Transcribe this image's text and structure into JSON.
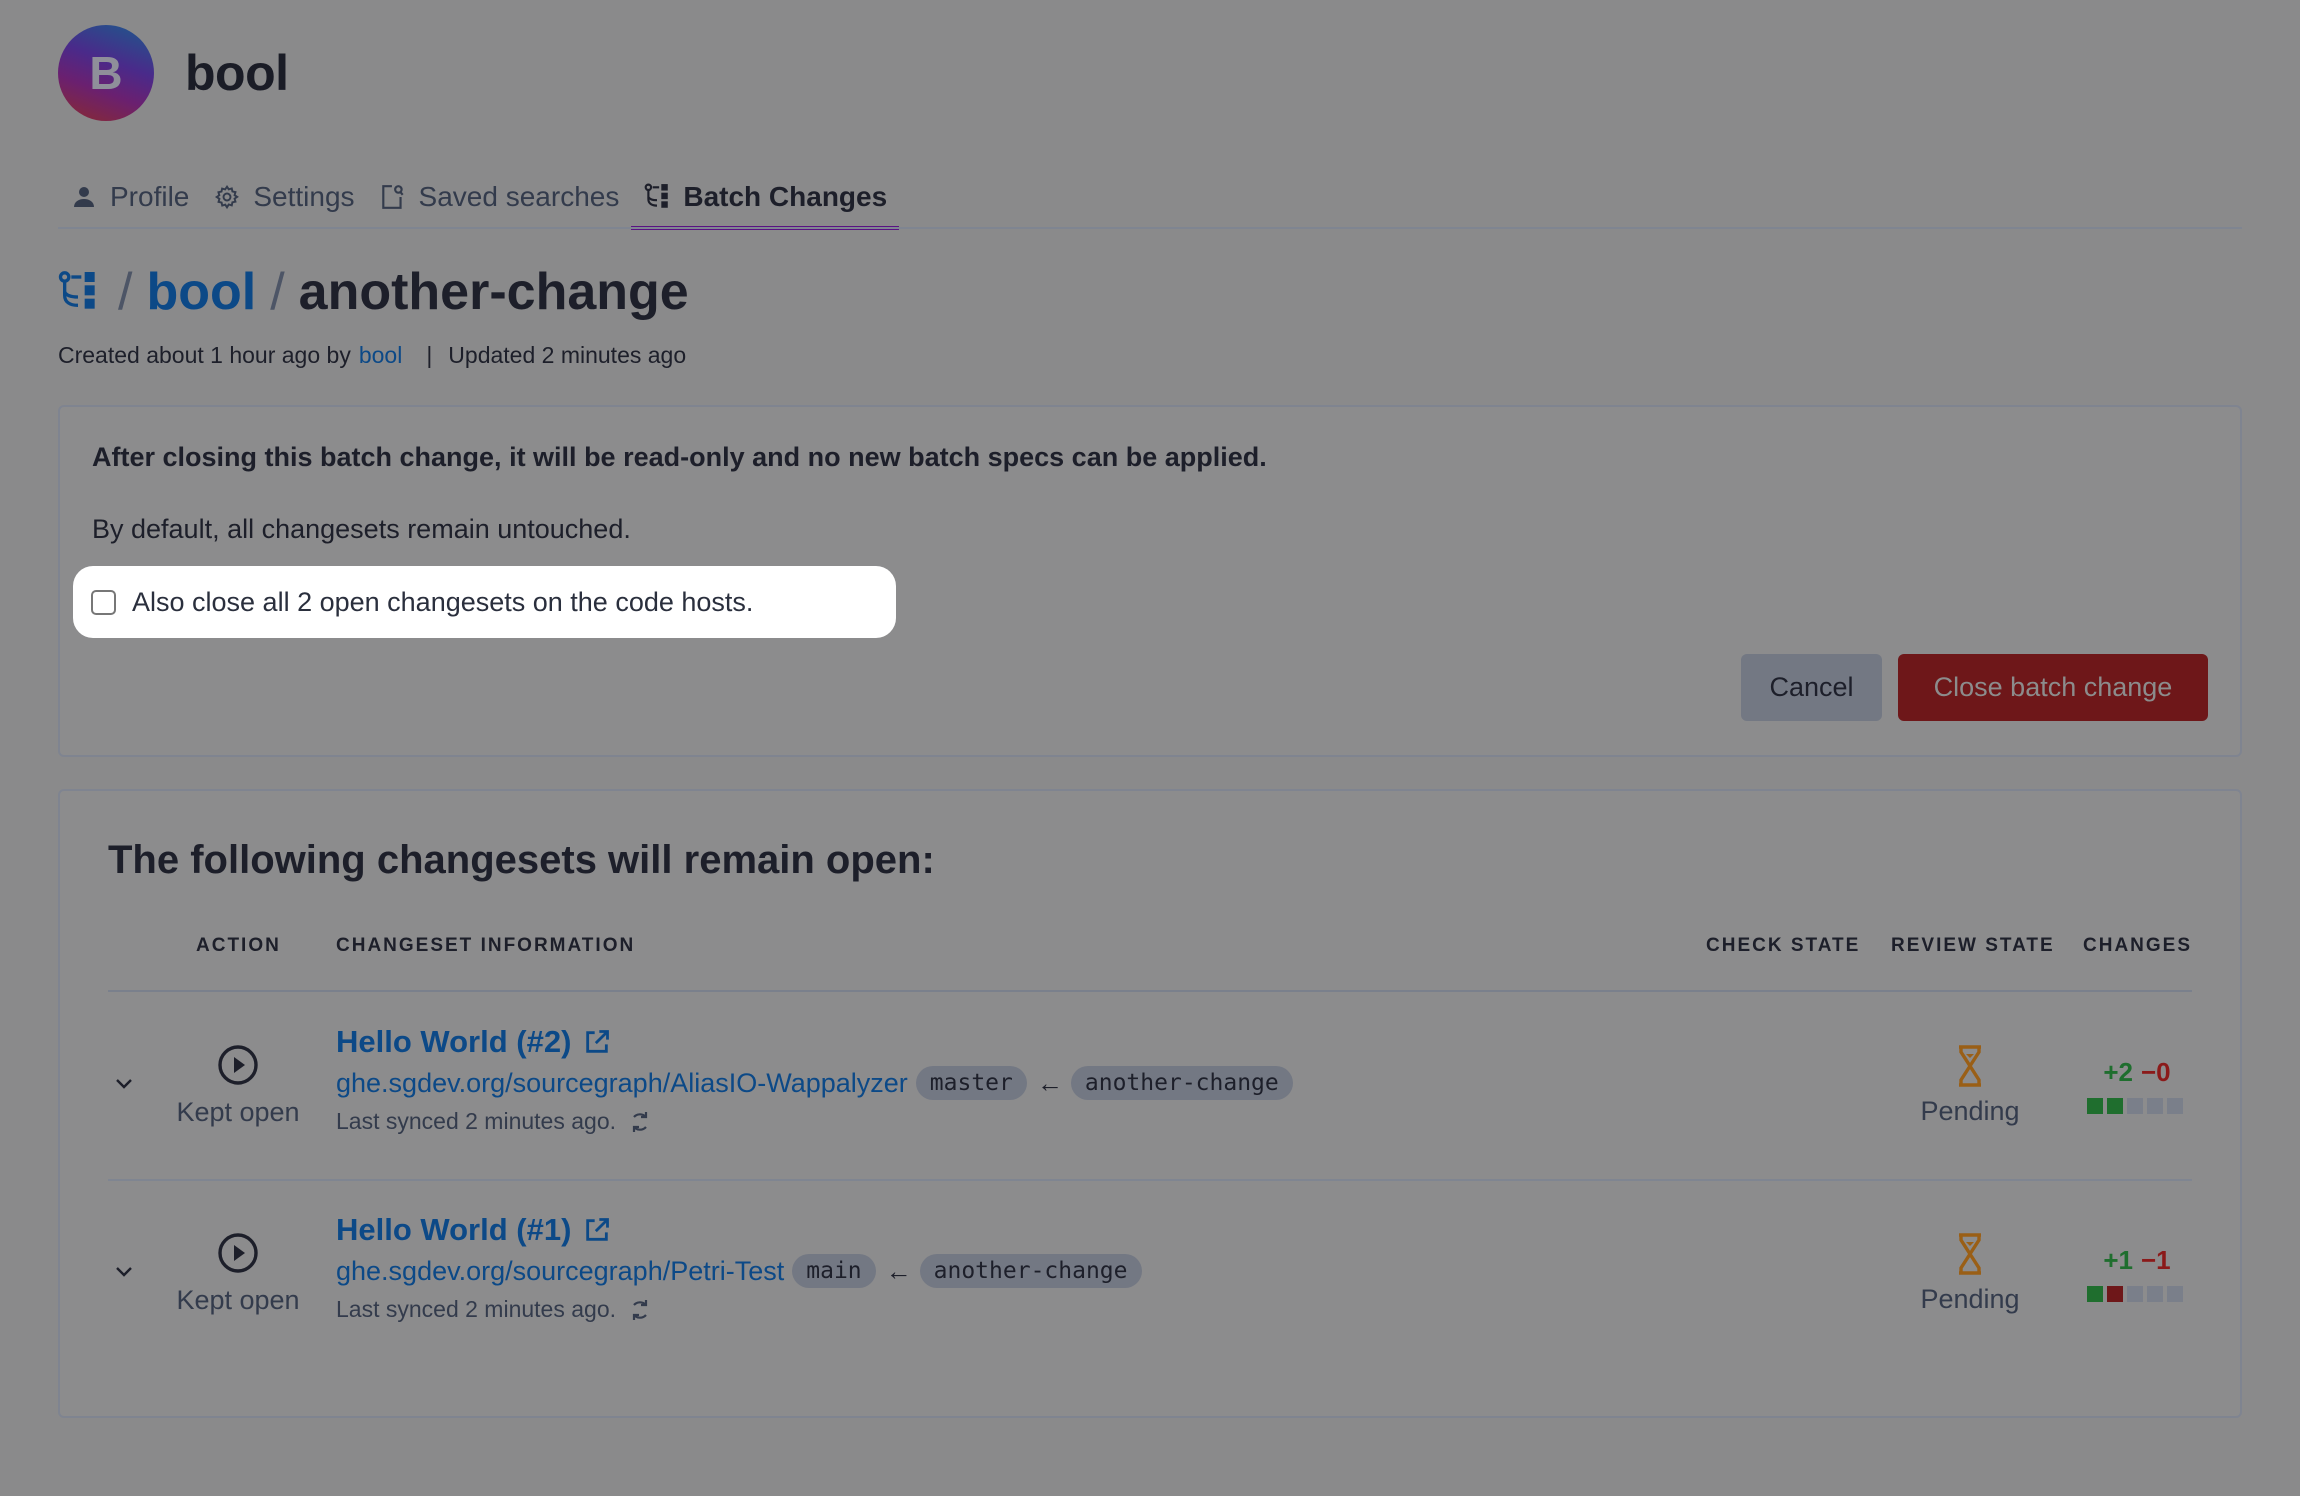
{
  "user": {
    "avatar_initial": "B",
    "name": "bool"
  },
  "tabs": [
    {
      "label": "Profile",
      "icon": "user-icon",
      "active": false
    },
    {
      "label": "Settings",
      "icon": "gear-icon",
      "active": false
    },
    {
      "label": "Saved searches",
      "icon": "saved-search-icon",
      "active": false
    },
    {
      "label": "Batch Changes",
      "icon": "batch-changes-icon",
      "active": true
    }
  ],
  "breadcrumb": {
    "namespace": "bool",
    "separator": "/",
    "batch_change": "another-change"
  },
  "meta": {
    "created_prefix": "Created about 1 hour ago by",
    "author": "bool",
    "separator": "|",
    "updated": "Updated 2 minutes ago"
  },
  "close_panel": {
    "warning": "After closing this batch change, it will be read-only and no new batch specs can be applied.",
    "note": "By default, all changesets remain untouched.",
    "checkbox_label": "Also close all 2 open changesets on the code hosts.",
    "checkbox_checked": false,
    "cancel_label": "Cancel",
    "close_label": "Close batch change"
  },
  "changesets_section": {
    "title": "The following changesets will remain open:",
    "columns": [
      "ACTION",
      "CHANGESET INFORMATION",
      "CHECK STATE",
      "REVIEW STATE",
      "CHANGES"
    ],
    "rows": [
      {
        "action": "Kept open",
        "title": "Hello World (#2)",
        "repo": "ghe.sgdev.org/sourcegraph/AliasIO-Wappalyzer",
        "base_branch": "master",
        "arrow": "←",
        "head_branch": "another-change",
        "synced": "Last synced 2 minutes ago.",
        "check_state": "",
        "review_state": "Pending",
        "added": "+2",
        "deleted": "−0",
        "diffstat_blocks": [
          "added",
          "added",
          "neutral",
          "neutral",
          "neutral"
        ]
      },
      {
        "action": "Kept open",
        "title": "Hello World (#1)",
        "repo": "ghe.sgdev.org/sourcegraph/Petri-Test",
        "base_branch": "main",
        "arrow": "←",
        "head_branch": "another-change",
        "synced": "Last synced 2 minutes ago.",
        "check_state": "",
        "review_state": "Pending",
        "added": "+1",
        "deleted": "−1",
        "diffstat_blocks": [
          "added",
          "deleted",
          "neutral",
          "neutral",
          "neutral"
        ]
      }
    ]
  },
  "colors": {
    "link": "#0c4987",
    "active_tab": "#5a1282",
    "danger": "#6e1719",
    "added": "#1f6e2e",
    "deleted": "#8b1a1a",
    "pending": "#9a5f16"
  }
}
